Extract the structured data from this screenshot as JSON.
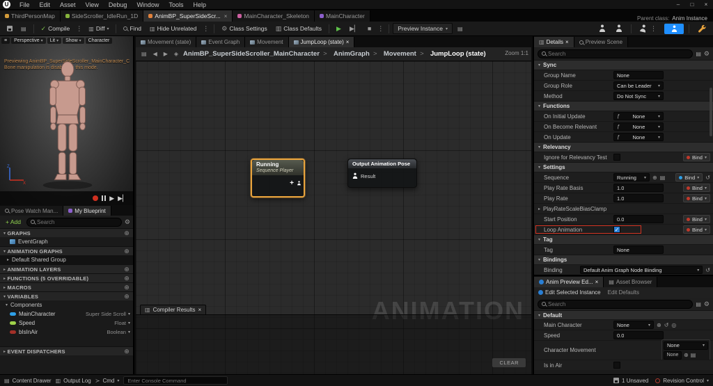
{
  "icons": {
    "caret": "▾",
    "caret_right": "▸",
    "close": "×",
    "plus": "+",
    "plus_circle": "⊕",
    "gear": "⚙",
    "reset": "↺",
    "fn": "ƒ",
    "check": "✓",
    "back": "◀",
    "forward": "▶",
    "play": "▶",
    "step": "▶▏",
    "stop": "■",
    "kebab": "⋮",
    "grid": "▤",
    "rows": "▥",
    "menu": "≡",
    "prompt": "≻",
    "minimize": "–",
    "maximize": "□",
    "eyedrop": "◎",
    "diamond": "◈"
  },
  "colors": {
    "accent_blue": "#1f8fff",
    "selection_orange": "#e8a33d",
    "compile_green": "#7ec24a",
    "bind_red": "#c0392b",
    "bind_blue": "#2e9fe6",
    "highlight_red": "#d23220"
  },
  "menubar": {
    "items": [
      "File",
      "Edit",
      "Asset",
      "View",
      "Debug",
      "Window",
      "Tools",
      "Help"
    ]
  },
  "doc_tabs": {
    "t1": "ThirdPersonMap",
    "t2": "SideScroller_IdleRun_1D",
    "t3": "AnimBP_SuperSideScr...",
    "t4": "MainCharacter_Skeleton",
    "t5": "MainCharacter",
    "colors": {
      "t1": "#d29a3a",
      "t2": "#86b33c",
      "t3": "#e0813c",
      "t4": "#cc5fa0",
      "t5": "#8c5fcc"
    },
    "parent_class_label": "Parent class:",
    "parent_class_value": "Anim Instance"
  },
  "toolbar": {
    "compile": "Compile",
    "diff": "Diff",
    "find": "Find",
    "hide_unrelated": "Hide Unrelated",
    "class_settings": "Class Settings",
    "class_defaults": "Class Defaults",
    "preview_instance": "Preview Instance"
  },
  "viewport": {
    "perspective": "Perspective",
    "lit": "Lit",
    "show": "Show",
    "character": "Character",
    "preview_line1": "Previewing AnimBP_SuperSideScroller_MainCharacter_C",
    "preview_line2": "Bone manipulation is disabled in this mode.",
    "axis_z": "Z",
    "axis_x": "X"
  },
  "my_blueprint": {
    "tab_pose_watch": "Pose Watch Man...",
    "tab_my_blueprint": "My Blueprint",
    "add_button": "+ Add",
    "search_placeholder": "Search",
    "graphs_header": "GRAPHS",
    "event_graph": "EventGraph",
    "animation_graphs_header": "ANIMATION GRAPHS",
    "default_shared_group": "Default Shared Group",
    "animation_layers_header": "ANIMATION LAYERS",
    "functions_header": "FUNCTIONS (5 OVERRIDABLE)",
    "macros_header": "MACROS",
    "variables_header": "VARIABLES",
    "components_header": "Components",
    "event_dispatchers_header": "EVENT DISPATCHERS",
    "variables": [
      {
        "name": "MainCharacter",
        "type": "Super Side Scroll",
        "color": "#2e9fe6"
      },
      {
        "name": "Speed",
        "type": "Float",
        "color": "#9fd24a"
      },
      {
        "name": "bIsInAir",
        "type": "Boolean",
        "color": "#a33028"
      }
    ]
  },
  "graph": {
    "tab1": "Movement (state)",
    "tab2": "Event Graph",
    "tab3": "Movement",
    "tab4": "JumpLoop (state)",
    "breadcrumb": [
      "AnimBP_SuperSideScroller_MainCharacter",
      "AnimGraph",
      "Movement",
      "JumpLoop (state)"
    ],
    "zoom": "Zoom 1:1",
    "watermark": "ANIMATION",
    "node_running": {
      "title": "Running",
      "subtitle": "Sequence Player"
    },
    "node_output": {
      "title": "Output Animation Pose",
      "pin": "Result"
    },
    "compiler_results": "Compiler Results",
    "clear": "CLEAR"
  },
  "details": {
    "tab_details": "Details",
    "tab_preview_scene": "Preview Scene",
    "search_placeholder": "Search",
    "bind": "Bind",
    "sync_header": "Sync",
    "group_name": {
      "label": "Group Name",
      "value": "None"
    },
    "group_role": {
      "label": "Group Role",
      "value": "Can be Leader"
    },
    "method": {
      "label": "Method",
      "value": "Do Not Sync"
    },
    "functions_header": "Functions",
    "on_initial_update": {
      "label": "On Initial Update",
      "value": "None"
    },
    "on_become_relevant": {
      "label": "On Become Relevant",
      "value": "None"
    },
    "on_update": {
      "label": "On Update",
      "value": "None"
    },
    "relevancy_header": "Relevancy",
    "ignore_relevancy": {
      "label": "Ignore for Relevancy Test"
    },
    "settings_header": "Settings",
    "sequence": {
      "label": "Sequence",
      "value": "Running"
    },
    "play_rate_basis": {
      "label": "Play Rate Basis",
      "value": "1.0"
    },
    "play_rate": {
      "label": "Play Rate",
      "value": "1.0"
    },
    "play_rate_clamp": {
      "label": "PlayRateScaleBiasClamp"
    },
    "start_position": {
      "label": "Start Position",
      "value": "0.0"
    },
    "loop_animation": {
      "label": "Loop Animation"
    },
    "tag_header": "Tag",
    "tag": {
      "label": "Tag",
      "value": "None"
    },
    "bindings_header": "Bindings",
    "binding": {
      "label": "Binding",
      "value": "Default Anim Graph Node Binding"
    }
  },
  "anim_preview": {
    "tab_editor": "Anim Preview Ed...",
    "tab_asset_browser": "Asset Browser",
    "edit_selected": "Edit Selected Instance",
    "edit_defaults": "Edit Defaults",
    "search_placeholder": "Search",
    "default_header": "Default",
    "main_character": {
      "label": "Main Character",
      "value": "None"
    },
    "speed": {
      "label": "Speed",
      "value": "0.0"
    },
    "character_movement": {
      "label": "Character Movement",
      "value": "None"
    },
    "is_in_air": {
      "label": "Is in Air"
    }
  },
  "statusbar": {
    "content_drawer": "Content Drawer",
    "output_log": "Output Log",
    "cmd": "Cmd",
    "console_placeholder": "Enter Console Command",
    "unsaved": "1 Unsaved",
    "revision_control": "Revision Control"
  }
}
